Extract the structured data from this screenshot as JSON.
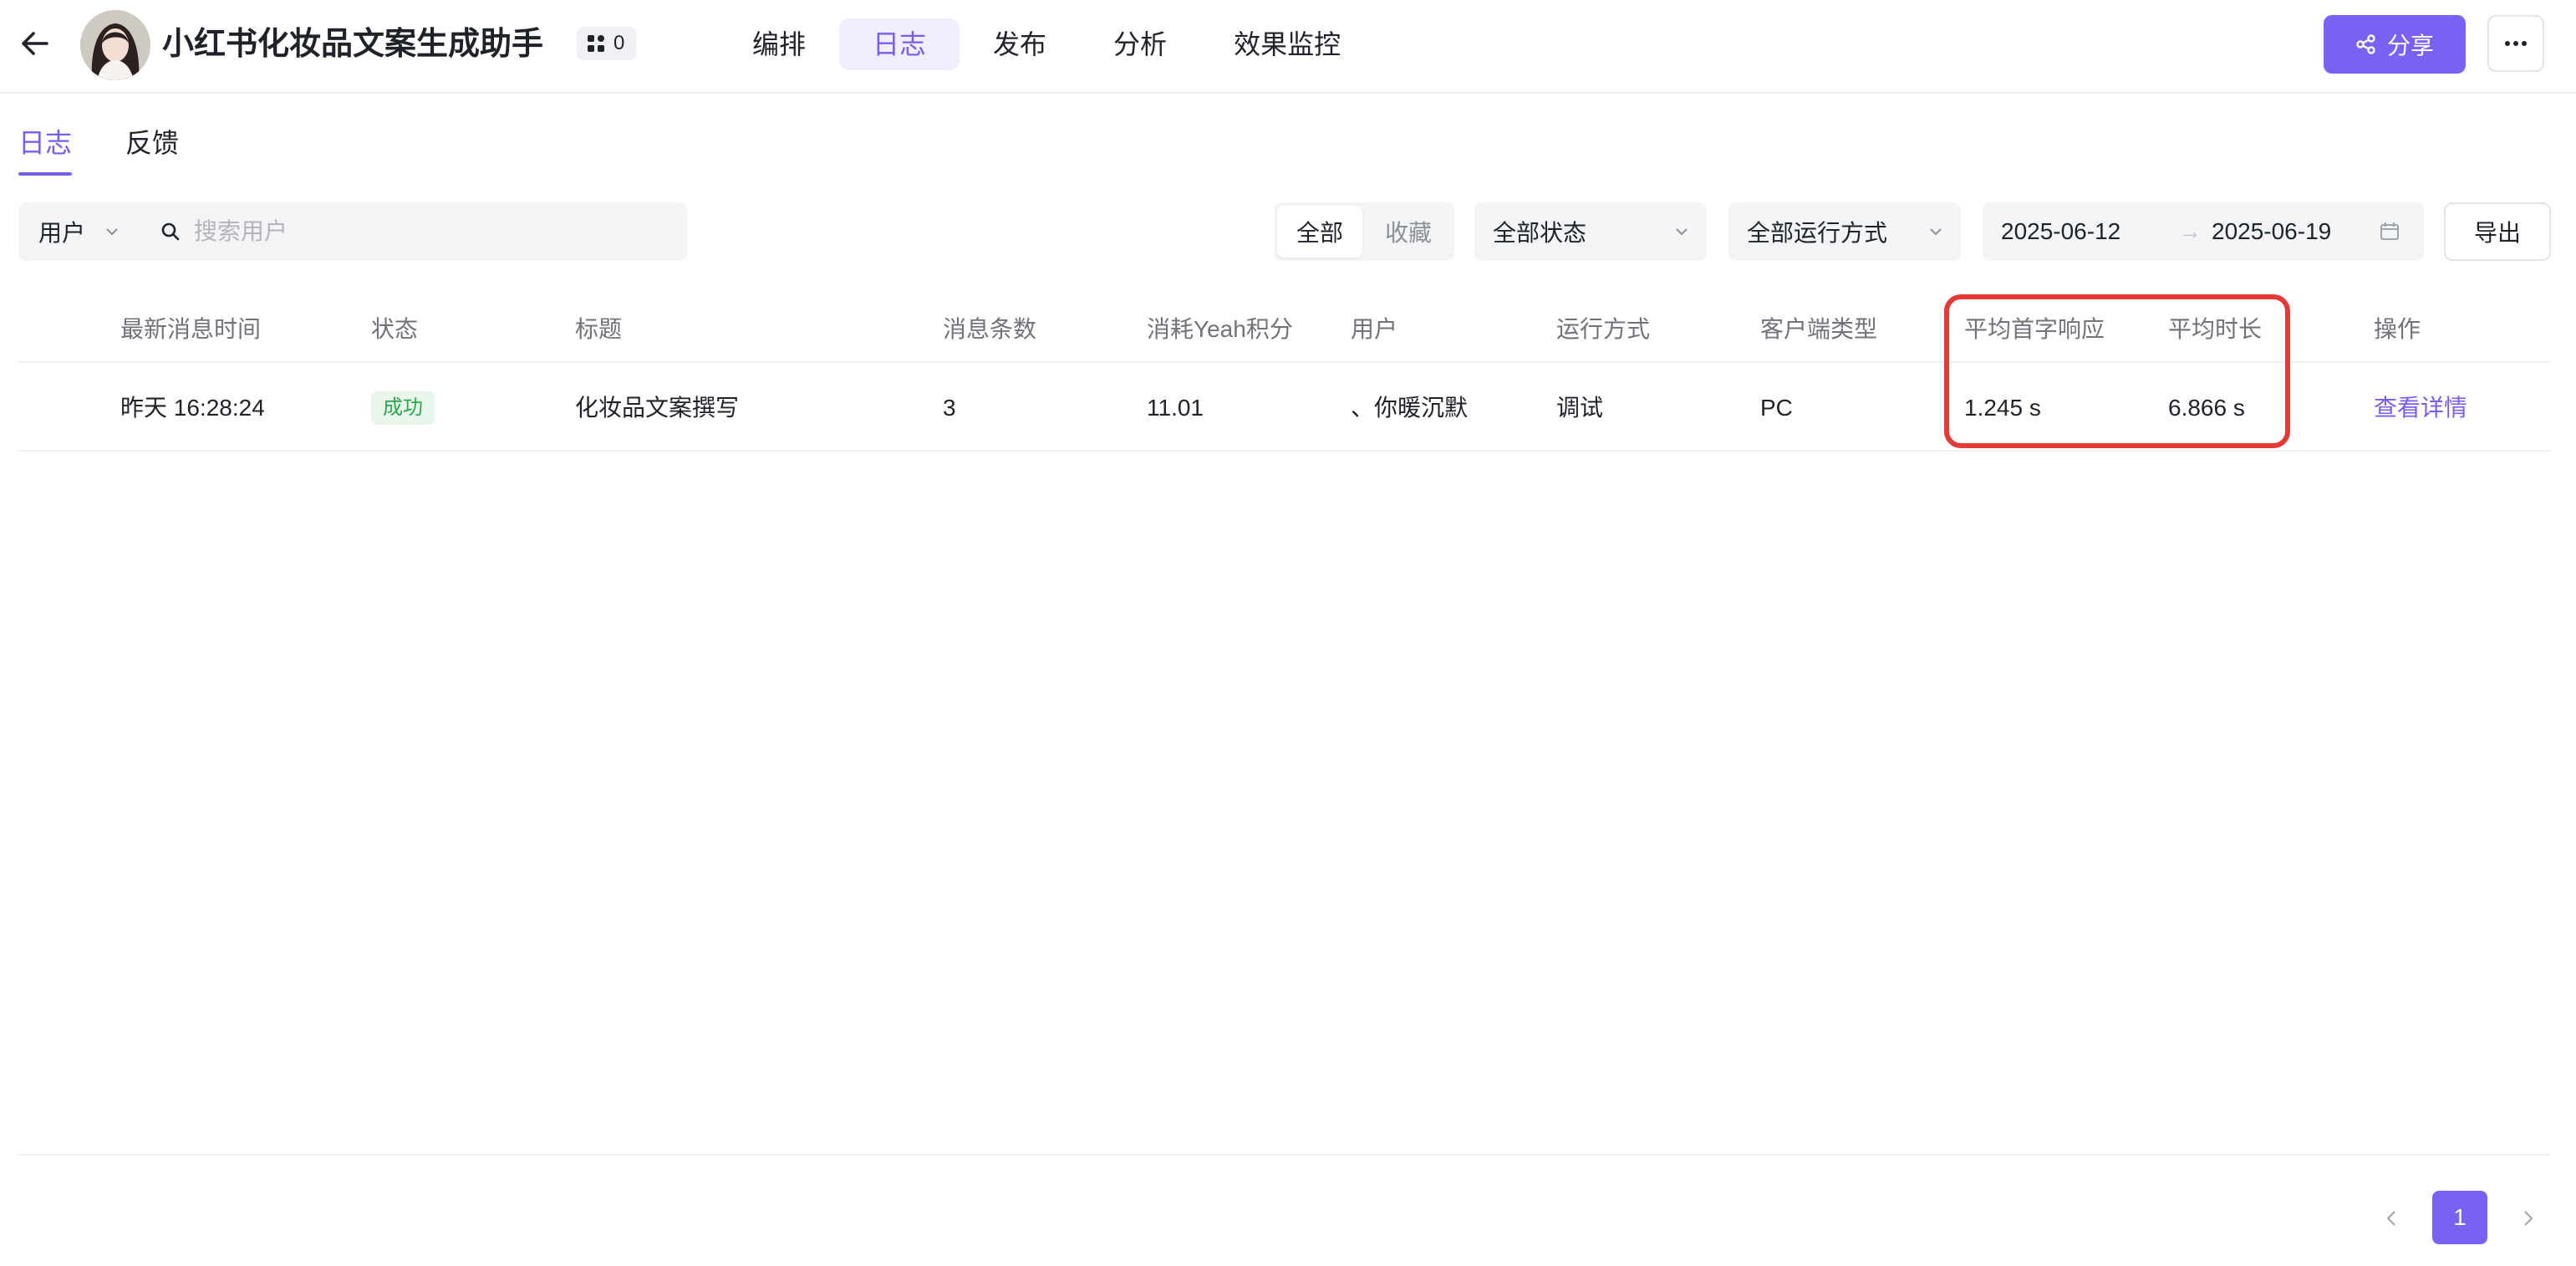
{
  "header": {
    "title": "小红书化妆品文案生成助手",
    "badge_count": "0",
    "nav": [
      "编排",
      "日志",
      "发布",
      "分析",
      "效果监控"
    ],
    "nav_active": "日志",
    "share_label": "分享"
  },
  "subtabs": [
    "日志",
    "反馈"
  ],
  "filters": {
    "user_select": "用户",
    "search_placeholder": "搜索用户",
    "segment": [
      "全部",
      "收藏"
    ],
    "status_select": "全部状态",
    "run_mode_select": "全部运行方式",
    "date_start": "2025-06-12",
    "date_separator": "→",
    "date_end": "2025-06-19",
    "export_label": "导出"
  },
  "table": {
    "columns": [
      "最新消息时间",
      "状态",
      "标题",
      "消息条数",
      "消耗Yeah积分",
      "用户",
      "运行方式",
      "客户端类型",
      "平均首字响应",
      "平均时长",
      "操作"
    ],
    "rows": [
      {
        "time": "昨天 16:28:24",
        "status": "成功",
        "title": "化妆品文案撰写",
        "messages": "3",
        "points": "11.01",
        "user": "、你暖沉默",
        "run_mode": "调试",
        "client": "PC",
        "avg_first_token": "1.245 s",
        "avg_duration": "6.866 s",
        "action": "查看详情"
      }
    ]
  },
  "pagination": {
    "current": "1"
  },
  "colors": {
    "accent": "#7b61f1",
    "success": "#2ba74c",
    "highlight": "#e53935"
  }
}
